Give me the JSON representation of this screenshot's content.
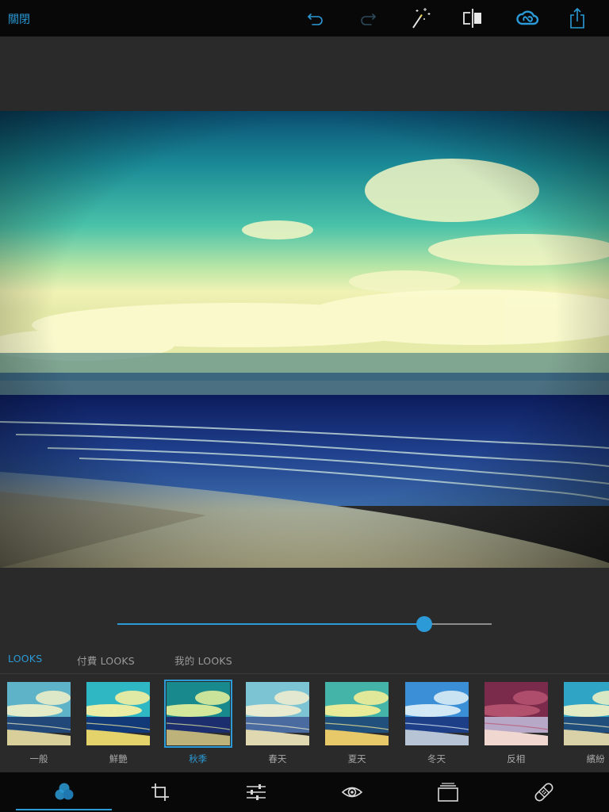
{
  "toolbar": {
    "close_label": "關閉",
    "icons": [
      "undo-icon",
      "redo-icon",
      "auto-fix-wand-icon",
      "compare-split-icon",
      "creative-cloud-icon",
      "share-icon"
    ]
  },
  "slider": {
    "value": 0.82
  },
  "tabs": [
    {
      "label": "LOOKS",
      "active": true
    },
    {
      "label": "付費 LOOKS",
      "active": false
    },
    {
      "label": "我的 LOOKS",
      "active": false
    }
  ],
  "looks": [
    {
      "label": "一般",
      "selected": false,
      "sky": "#5fb3c9",
      "cloud": "#f3f1c8",
      "sea": "#22487a",
      "sand": "#d8cf9a"
    },
    {
      "label": "鮮艷",
      "selected": false,
      "sky": "#2fb7c4",
      "cloud": "#fff3a0",
      "sea": "#133a78",
      "sand": "#e4d36b"
    },
    {
      "label": "秋季",
      "selected": true,
      "sky": "#188a8d",
      "cloud": "#e9f29d",
      "sea": "#1c2e6e",
      "sand": "#bdb37a"
    },
    {
      "label": "春天",
      "selected": false,
      "sky": "#7cc3d4",
      "cloud": "#f4f0cf",
      "sea": "#4a6ba0",
      "sand": "#e0d8b0"
    },
    {
      "label": "夏天",
      "selected": false,
      "sky": "#44b4a8",
      "cloud": "#fdf196",
      "sea": "#22507c",
      "sand": "#e8c96a"
    },
    {
      "label": "冬天",
      "selected": false,
      "sky": "#3b8fd6",
      "cloud": "#e4f2f8",
      "sea": "#1d3f88",
      "sand": "#b7c4d6"
    },
    {
      "label": "反相",
      "selected": false,
      "sky": "#7a2a4a",
      "cloud": "#b85572",
      "sea": "#b8a8c8",
      "sand": "#f0d8d0"
    },
    {
      "label": "繽紛",
      "selected": false,
      "sky": "#2fa4c4",
      "cloud": "#f6f3c4",
      "sea": "#1f4e7c",
      "sand": "#d9d2a8"
    }
  ],
  "bottom_tools": [
    {
      "name": "looks-tool-icon",
      "active": true
    },
    {
      "name": "crop-tool-icon",
      "active": false
    },
    {
      "name": "adjustments-tool-icon",
      "active": false
    },
    {
      "name": "red-eye-tool-icon",
      "active": false
    },
    {
      "name": "frames-tool-icon",
      "active": false
    },
    {
      "name": "healing-bandage-tool-icon",
      "active": false
    }
  ],
  "colors": {
    "accent": "#2b9ad6",
    "topbar": "#080808",
    "canvas": "#2a2a2a"
  }
}
